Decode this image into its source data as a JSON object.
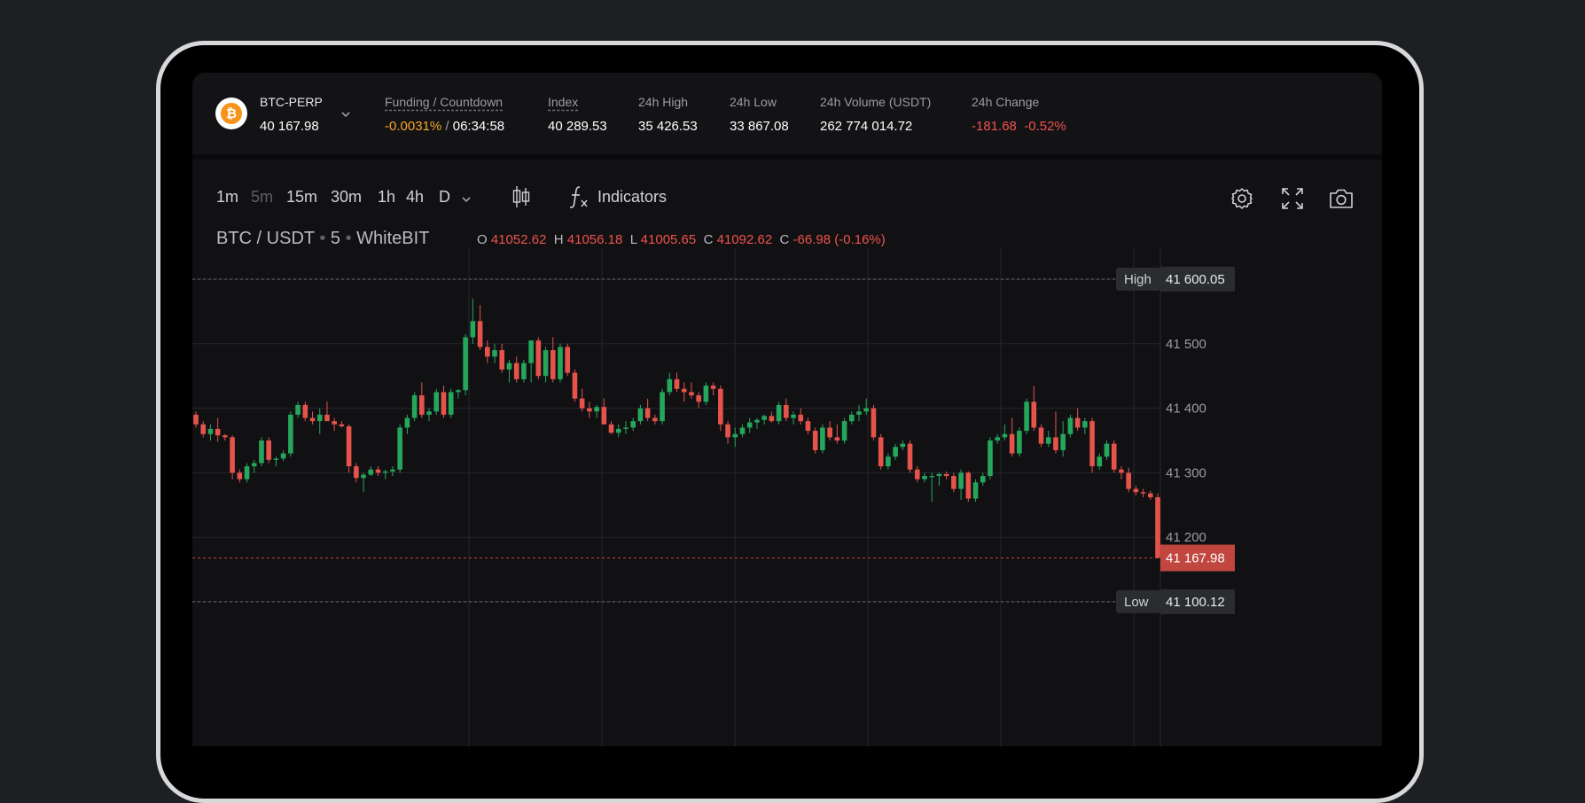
{
  "ticker": {
    "symbol": "BTC-PERP",
    "price": "40 167.98",
    "funding_label": "Funding / Countdown",
    "funding_rate": "-0.0031%",
    "funding_sep": "/",
    "countdown": "06:34:58",
    "index_label": "Index",
    "index_value": "40 289.53",
    "high_label": "24h High",
    "high_value": "35 426.53",
    "low_label": "24h Low",
    "low_value": "33 867.08",
    "volume_label": "24h Volume (USDT)",
    "volume_value": "262 774 014.72",
    "change_label": "24h Change",
    "change_abs": "-181.68",
    "change_pct": "-0.52%"
  },
  "toolbar": {
    "timeframes": [
      {
        "label": "1m",
        "active": false
      },
      {
        "label": "5m",
        "active": true
      },
      {
        "label": "15m",
        "active": false
      },
      {
        "label": "30m",
        "active": false
      },
      {
        "label": "1h",
        "active": false
      },
      {
        "label": "4h",
        "active": false
      },
      {
        "label": "D",
        "active": false
      }
    ],
    "indicators_label": "Indicators",
    "icons": [
      "chevron-down-icon",
      "candles-icon",
      "function-icon",
      "gear-icon",
      "fullscreen-icon",
      "camera-icon"
    ]
  },
  "legend": {
    "pair": "BTC / USDT",
    "interval": "5",
    "exchange": "WhiteBIT",
    "o_label": "O",
    "o_value": "41052.62",
    "h_label": "H",
    "h_value": "41056.18",
    "l_label": "L",
    "l_value": "41005.65",
    "c_label": "C",
    "c_value": "41092.62",
    "chg_label": "C",
    "chg_value": "-66.98 (-0.16%)"
  },
  "colors": {
    "up": "#26a65b",
    "down": "#e5534b",
    "background": "#111114",
    "grid": "#25262a",
    "accent_orange": "#f5a623"
  },
  "chart_data": {
    "type": "candlestick",
    "y_axis": {
      "ticks": [
        41600,
        41500,
        41400,
        41300,
        41200,
        41100
      ],
      "tick_labels": [
        "41 600",
        "41 500",
        "41 400",
        "41 300",
        "41 200",
        "41 100"
      ]
    },
    "high_marker": {
      "label": "High",
      "value": 41600.05,
      "value_label": "41 600.05"
    },
    "low_marker": {
      "label": "Low",
      "value": 41100.12,
      "value_label": "41 100.12"
    },
    "last_price": {
      "value": 41167.98,
      "value_label": "41 167.98"
    },
    "candles": [
      [
        41390,
        41395,
        41370,
        41375
      ],
      [
        41375,
        41380,
        41355,
        41360
      ],
      [
        41360,
        41375,
        41350,
        41368
      ],
      [
        41368,
        41385,
        41348,
        41358
      ],
      [
        41358,
        41360,
        41350,
        41355
      ],
      [
        41355,
        41358,
        41290,
        41300
      ],
      [
        41300,
        41305,
        41285,
        41290
      ],
      [
        41290,
        41315,
        41285,
        41310
      ],
      [
        41310,
        41320,
        41300,
        41315
      ],
      [
        41315,
        41355,
        41310,
        41350
      ],
      [
        41350,
        41355,
        41315,
        41320
      ],
      [
        41320,
        41325,
        41310,
        41322
      ],
      [
        41322,
        41335,
        41318,
        41330
      ],
      [
        41330,
        41395,
        41325,
        41390
      ],
      [
        41390,
        41410,
        41385,
        41405
      ],
      [
        41405,
        41410,
        41380,
        41385
      ],
      [
        41385,
        41395,
        41375,
        41380
      ],
      [
        41380,
        41400,
        41360,
        41390
      ],
      [
        41390,
        41410,
        41380,
        41380
      ],
      [
        41380,
        41385,
        41365,
        41375
      ],
      [
        41375,
        41380,
        41370,
        41372
      ],
      [
        41372,
        41375,
        41300,
        41310
      ],
      [
        41310,
        41315,
        41285,
        41292
      ],
      [
        41292,
        41300,
        41270,
        41297
      ],
      [
        41297,
        41310,
        41295,
        41305
      ],
      [
        41305,
        41310,
        41295,
        41300
      ],
      [
        41300,
        41305,
        41290,
        41302
      ],
      [
        41302,
        41310,
        41295,
        41305
      ],
      [
        41305,
        41375,
        41300,
        41370
      ],
      [
        41370,
        41390,
        41360,
        41385
      ],
      [
        41385,
        41425,
        41380,
        41420
      ],
      [
        41420,
        41440,
        41385,
        41390
      ],
      [
        41390,
        41400,
        41380,
        41395
      ],
      [
        41395,
        41430,
        41390,
        41425
      ],
      [
        41425,
        41435,
        41385,
        41390
      ],
      [
        41390,
        41430,
        41385,
        41425
      ],
      [
        41425,
        41430,
        41415,
        41428
      ],
      [
        41428,
        41515,
        41420,
        41510
      ],
      [
        41510,
        41570,
        41500,
        41535
      ],
      [
        41535,
        41560,
        41490,
        41495
      ],
      [
        41495,
        41505,
        41470,
        41480
      ],
      [
        41480,
        41500,
        41470,
        41490
      ],
      [
        41490,
        41500,
        41455,
        41460
      ],
      [
        41460,
        41475,
        41440,
        41470
      ],
      [
        41470,
        41480,
        41440,
        41445
      ],
      [
        41445,
        41475,
        41440,
        41470
      ],
      [
        41470,
        41505,
        41440,
        41505
      ],
      [
        41505,
        41510,
        41445,
        41450
      ],
      [
        41450,
        41495,
        41440,
        41490
      ],
      [
        41490,
        41510,
        41440,
        41445
      ],
      [
        41445,
        41500,
        41440,
        41495
      ],
      [
        41495,
        41500,
        41450,
        41455
      ],
      [
        41455,
        41460,
        41410,
        41415
      ],
      [
        41415,
        41430,
        41395,
        41400
      ],
      [
        41400,
        41410,
        41385,
        41395
      ],
      [
        41395,
        41405,
        41385,
        41402
      ],
      [
        41402,
        41415,
        41375,
        41375
      ],
      [
        41375,
        41380,
        41360,
        41362
      ],
      [
        41362,
        41375,
        41355,
        41368
      ],
      [
        41368,
        41380,
        41360,
        41370
      ],
      [
        41370,
        41385,
        41365,
        41380
      ],
      [
        41380,
        41405,
        41375,
        41400
      ],
      [
        41400,
        41415,
        41380,
        41385
      ],
      [
        41385,
        41390,
        41375,
        41380
      ],
      [
        41380,
        41430,
        41375,
        41425
      ],
      [
        41425,
        41455,
        41420,
        41445
      ],
      [
        41445,
        41455,
        41425,
        41430
      ],
      [
        41430,
        41440,
        41410,
        41425
      ],
      [
        41425,
        41440,
        41415,
        41420
      ],
      [
        41420,
        41425,
        41400,
        41410
      ],
      [
        41410,
        41440,
        41405,
        41435
      ],
      [
        41435,
        41440,
        41420,
        41430
      ],
      [
        41430,
        41435,
        41365,
        41375
      ],
      [
        41375,
        41380,
        41345,
        41355
      ],
      [
        41355,
        41370,
        41340,
        41360
      ],
      [
        41360,
        41375,
        41355,
        41370
      ],
      [
        41370,
        41385,
        41362,
        41378
      ],
      [
        41378,
        41385,
        41368,
        41382
      ],
      [
        41382,
        41390,
        41375,
        41388
      ],
      [
        41388,
        41395,
        41378,
        41380
      ],
      [
        41380,
        41410,
        41375,
        41405
      ],
      [
        41405,
        41415,
        41380,
        41385
      ],
      [
        41385,
        41395,
        41375,
        41390
      ],
      [
        41390,
        41400,
        41375,
        41380
      ],
      [
        41380,
        41385,
        41360,
        41365
      ],
      [
        41365,
        41370,
        41330,
        41335
      ],
      [
        41335,
        41375,
        41330,
        41370
      ],
      [
        41370,
        41380,
        41350,
        41355
      ],
      [
        41355,
        41375,
        41345,
        41350
      ],
      [
        41350,
        41385,
        41345,
        41380
      ],
      [
        41380,
        41395,
        41375,
        41390
      ],
      [
        41390,
        41405,
        41380,
        41395
      ],
      [
        41395,
        41415,
        41390,
        41400
      ],
      [
        41400,
        41405,
        41350,
        41355
      ],
      [
        41355,
        41360,
        41305,
        41310
      ],
      [
        41310,
        41330,
        41305,
        41325
      ],
      [
        41325,
        41345,
        41320,
        41340
      ],
      [
        41340,
        41350,
        41335,
        41345
      ],
      [
        41345,
        41350,
        41300,
        41305
      ],
      [
        41305,
        41310,
        41285,
        41290
      ],
      [
        41290,
        41300,
        41285,
        41295
      ],
      [
        41295,
        41300,
        41255,
        41295
      ],
      [
        41295,
        41300,
        41280,
        41298
      ],
      [
        41298,
        41302,
        41290,
        41295
      ],
      [
        41295,
        41300,
        41270,
        41275
      ],
      [
        41275,
        41305,
        41258,
        41300
      ],
      [
        41300,
        41302,
        41255,
        41260
      ],
      [
        41260,
        41290,
        41255,
        41285
      ],
      [
        41285,
        41300,
        41280,
        41295
      ],
      [
        41295,
        41355,
        41290,
        41350
      ],
      [
        41350,
        41360,
        41345,
        41355
      ],
      [
        41355,
        41375,
        41350,
        41360
      ],
      [
        41360,
        41385,
        41325,
        41330
      ],
      [
        41330,
        41370,
        41325,
        41365
      ],
      [
        41365,
        41415,
        41360,
        41410
      ],
      [
        41410,
        41435,
        41365,
        41370
      ],
      [
        41370,
        41375,
        41340,
        41345
      ],
      [
        41345,
        41365,
        41340,
        41355
      ],
      [
        41355,
        41395,
        41330,
        41335
      ],
      [
        41335,
        41380,
        41325,
        41360
      ],
      [
        41360,
        41390,
        41355,
        41385
      ],
      [
        41385,
        41400,
        41365,
        41370
      ],
      [
        41370,
        41385,
        41360,
        41380
      ],
      [
        41380,
        41385,
        41300,
        41310
      ],
      [
        41310,
        41330,
        41305,
        41325
      ],
      [
        41325,
        41350,
        41320,
        41345
      ],
      [
        41345,
        41350,
        41300,
        41305
      ],
      [
        41305,
        41310,
        41290,
        41300
      ],
      [
        41300,
        41308,
        41270,
        41275
      ],
      [
        41275,
        41280,
        41265,
        41270
      ],
      [
        41270,
        41275,
        41262,
        41268
      ],
      [
        41268,
        41272,
        41258,
        41262
      ],
      [
        41262,
        41268,
        41168,
        41168
      ]
    ]
  }
}
